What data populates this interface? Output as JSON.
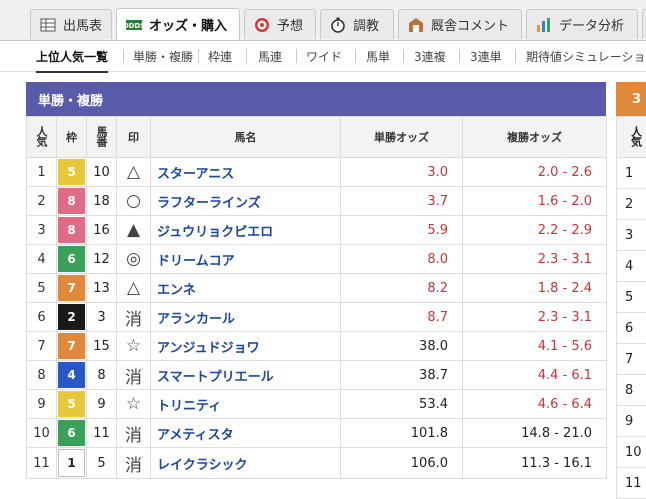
{
  "tabs": [
    {
      "label": "出馬表",
      "icon": "table-icon"
    },
    {
      "label": "オッズ・購入",
      "icon": "odds-ticket-icon",
      "active": true
    },
    {
      "label": "予想",
      "icon": "target-icon"
    },
    {
      "label": "調教",
      "icon": "stopwatch-icon"
    },
    {
      "label": "厩舎コメント",
      "icon": "stable-icon"
    },
    {
      "label": "データ分析",
      "icon": "bar-chart-icon"
    }
  ],
  "subnav": [
    "上位人気一覧",
    "単勝・複勝",
    "枠連",
    "馬連",
    "ワイド",
    "馬単",
    "3連複",
    "3連単",
    "期待値シミュレーショ"
  ],
  "panel": {
    "title": "単勝・複勝",
    "headers": {
      "pop": "人気",
      "frame": "枠",
      "num": "馬番",
      "mark": "印",
      "name": "馬名",
      "win": "単勝オッズ",
      "place": "複勝オッズ"
    },
    "rows": [
      {
        "pop": "1",
        "frame": "5",
        "num": "10",
        "mark": "△",
        "name": "スターアニス",
        "win": "3.0",
        "place": "2.0 - 2.6",
        "hot": true
      },
      {
        "pop": "2",
        "frame": "8",
        "num": "18",
        "mark": "○",
        "name": "ラフターラインズ",
        "win": "3.7",
        "place": "1.6 - 2.0",
        "hot": true
      },
      {
        "pop": "3",
        "frame": "8",
        "num": "16",
        "mark": "▲",
        "name": "ジュウリョクピエロ",
        "win": "5.9",
        "place": "2.2 - 2.9",
        "hot": true
      },
      {
        "pop": "4",
        "frame": "6",
        "num": "12",
        "mark": "◎",
        "name": "ドリームコア",
        "win": "8.0",
        "place": "2.3 - 3.1",
        "hot": true
      },
      {
        "pop": "5",
        "frame": "7",
        "num": "13",
        "mark": "△",
        "name": "エンネ",
        "win": "8.2",
        "place": "1.8 - 2.4",
        "hot": true
      },
      {
        "pop": "6",
        "frame": "2",
        "num": "3",
        "mark": "消",
        "name": "アランカール",
        "win": "8.7",
        "place": "2.3 - 3.1",
        "hot": true
      },
      {
        "pop": "7",
        "frame": "7",
        "num": "15",
        "mark": "☆",
        "name": "アンジュドジョワ",
        "win": "38.0",
        "place": "4.1 - 5.6",
        "hot": false
      },
      {
        "pop": "8",
        "frame": "4",
        "num": "8",
        "mark": "消",
        "name": "スマートプリエール",
        "win": "38.7",
        "place": "4.4 - 6.1",
        "hot": false
      },
      {
        "pop": "9",
        "frame": "5",
        "num": "9",
        "mark": "☆",
        "name": "トリニティ",
        "win": "53.4",
        "place": "4.6 - 6.4",
        "hot": false
      },
      {
        "pop": "10",
        "frame": "6",
        "num": "11",
        "mark": "消",
        "name": "アメティスタ",
        "win": "101.8",
        "place": "14.8 - 21.0",
        "hot": false
      },
      {
        "pop": "11",
        "frame": "1",
        "num": "5",
        "mark": "消",
        "name": "レイクラシック",
        "win": "106.0",
        "place": "11.3 - 16.1",
        "hot": false
      }
    ]
  },
  "panel2": {
    "title": "3",
    "header": "人気",
    "rows": [
      "1",
      "2",
      "3",
      "4",
      "5",
      "6",
      "7",
      "8",
      "9",
      "10",
      "11"
    ]
  },
  "colors": {
    "frame_1": "#ffffff",
    "frame_2": "#1a1a1a",
    "frame_4": "#2a56c6",
    "frame_5": "#e8c83a",
    "frame_6": "#3aa05a",
    "frame_7": "#e0893a",
    "frame_8": "#e06b86",
    "panel_head": "#5a5aac",
    "panel2_head": "#e0893a",
    "odds_hot": "#cc3333"
  }
}
